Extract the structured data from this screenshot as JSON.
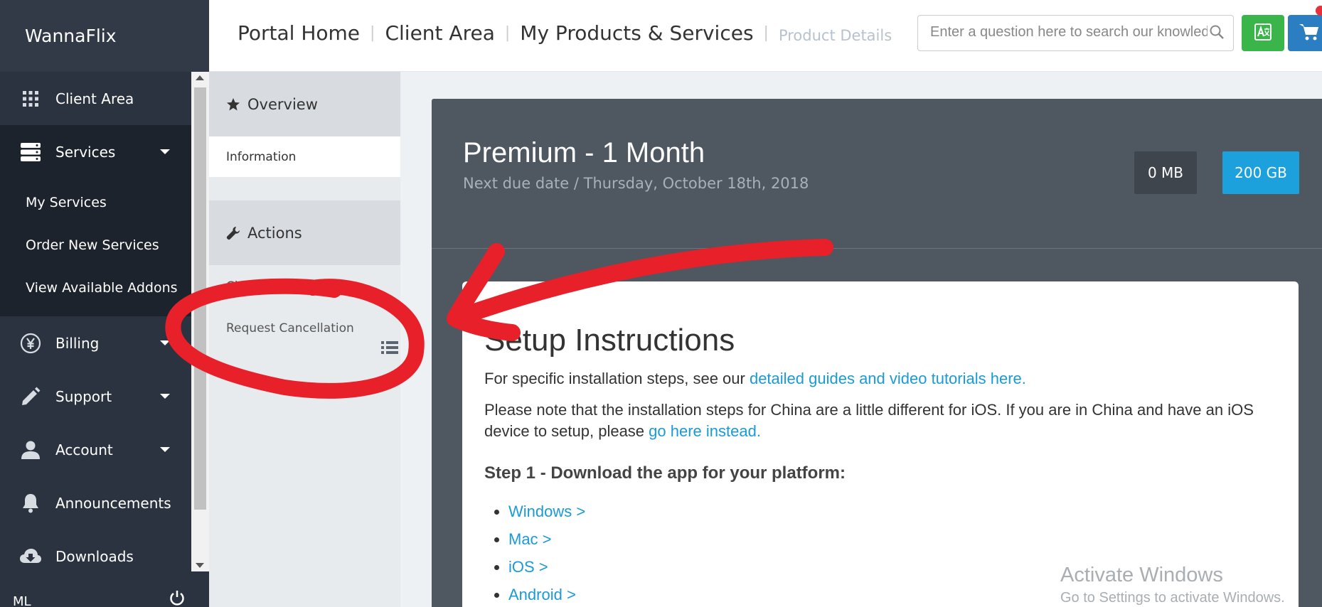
{
  "app": {
    "brand": "WannaFlix"
  },
  "sidebar": {
    "items": [
      {
        "label": "Client Area",
        "icon": "grid-icon"
      },
      {
        "label": "Services",
        "icon": "server-icon",
        "expanded": true,
        "sub": [
          "My Services",
          "Order New Services",
          "View Available Addons"
        ]
      },
      {
        "label": "Billing",
        "icon": "yen-icon"
      },
      {
        "label": "Support",
        "icon": "pencil-icon"
      },
      {
        "label": "Account",
        "icon": "user-icon"
      },
      {
        "label": "Announcements",
        "icon": "bell-icon"
      },
      {
        "label": "Downloads",
        "icon": "cloud-download-icon"
      }
    ],
    "user_initials": "ML"
  },
  "header": {
    "breadcrumb": [
      "Portal Home",
      "Client Area",
      "My Products & Services"
    ],
    "breadcrumb_current": "Product Details",
    "search_placeholder": "Enter a question here to search our knowledgebase"
  },
  "panel": {
    "overview_title": "Overview",
    "overview_item": "Information",
    "actions_title": "Actions",
    "actions": [
      "Change Password",
      "Request Cancellation"
    ]
  },
  "product": {
    "title": "Premium - 1 Month",
    "subtitle": "Next due date / Thursday, October 18th, 2018",
    "usage": "0 MB",
    "limit": "200 GB"
  },
  "setup": {
    "heading": "Setup Instructions",
    "p1_text": "For specific installation steps, see our ",
    "p1_link": "detailed guides and video tutorials here.",
    "p2_text": "Please note that the installation steps for China are a little different for iOS. If you are in China and have an iOS device to setup, please ",
    "p2_link": "go here instead.",
    "step1": "Step 1 - Download the app for your platform:",
    "platforms": [
      "Windows >",
      "Mac >",
      "iOS >",
      "Android >"
    ]
  },
  "watermark": {
    "line1": "Activate Windows",
    "line2": "Go to Settings to activate Windows."
  },
  "colors": {
    "sidebar_bg": "#2b3340",
    "hero_bg": "#4f5760",
    "accent_blue": "#1da1dc",
    "link": "#1a9ad6",
    "lang_btn": "#3ab54a",
    "cart_btn": "#2b7ec1",
    "annotation_red": "#e8202a"
  }
}
